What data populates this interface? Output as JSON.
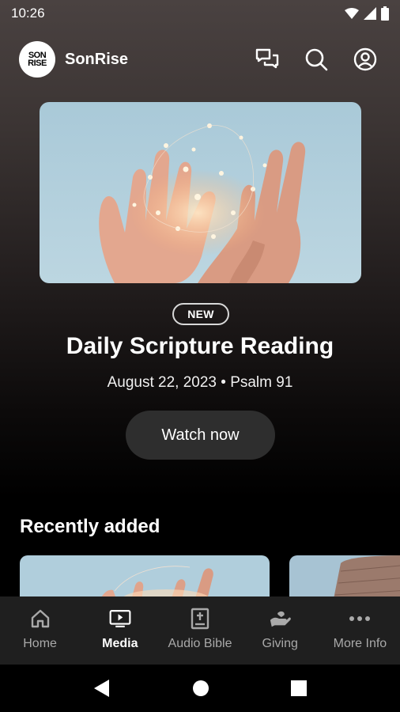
{
  "status_bar": {
    "time": "10:26",
    "icons": [
      "wifi-icon",
      "signal-icon",
      "battery-icon"
    ]
  },
  "header": {
    "logo_text": [
      "SON",
      "RISE"
    ],
    "app_name": "SonRise",
    "actions": [
      "chat-icon",
      "search-icon",
      "account-icon"
    ]
  },
  "hero": {
    "badge": "NEW",
    "title": "Daily Scripture Reading",
    "subtitle": "August 22, 2023 • Psalm 91",
    "button_label": "Watch now"
  },
  "recent": {
    "title": "Recently added"
  },
  "bottom_nav": {
    "items": [
      {
        "label": "Home",
        "icon": "home-icon",
        "active": false
      },
      {
        "label": "Media",
        "icon": "media-icon",
        "active": true
      },
      {
        "label": "Audio Bible",
        "icon": "bible-icon",
        "active": false
      },
      {
        "label": "Giving",
        "icon": "giving-icon",
        "active": false
      },
      {
        "label": "More Info",
        "icon": "more-icon",
        "active": false
      }
    ]
  },
  "colors": {
    "background": "#000000",
    "nav_background": "#1f1f1f",
    "button_background": "#2e2e2e",
    "inactive": "#a9a9a9"
  }
}
